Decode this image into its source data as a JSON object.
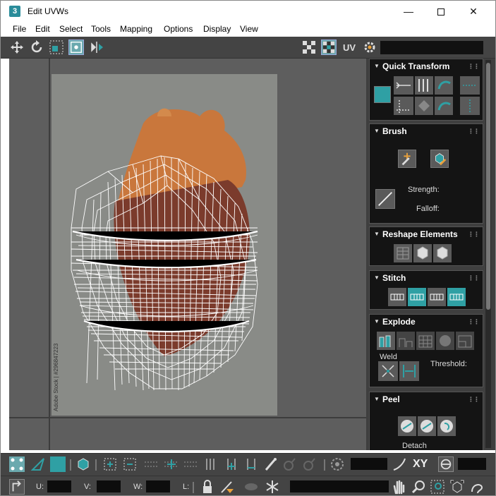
{
  "window": {
    "app_badge": "3",
    "title": "Edit UVWs",
    "minimize": "—",
    "close": "✕"
  },
  "menu": [
    "File",
    "Edit",
    "Select",
    "Tools",
    "Mapping",
    "Options",
    "Display",
    "View"
  ],
  "toolbar": {
    "uv_label": "UV"
  },
  "rollouts": {
    "quick_transform": "Quick Transform",
    "brush": {
      "title": "Brush",
      "strength_label": "Strength:",
      "falloff_label": "Falloff:"
    },
    "reshape": "Reshape Elements",
    "stitch": "Stitch",
    "explode": {
      "title": "Explode",
      "weld_label": "Weld",
      "threshold_label": "Threshold:"
    },
    "peel": {
      "title": "Peel",
      "detach_label": "Detach"
    }
  },
  "viewport": {
    "watermark": "Adobe Stock | #296847223"
  },
  "bottom": {
    "xy_label": "XY",
    "u_label": "U:",
    "v_label": "V:",
    "w_label": "W:",
    "l_label": "L:"
  },
  "colors": {
    "accent": "#2fa0a4",
    "panel_bg": "#3f3f3f",
    "rollout_bg": "#141414",
    "viewport_bg": "#5e5e5e"
  }
}
